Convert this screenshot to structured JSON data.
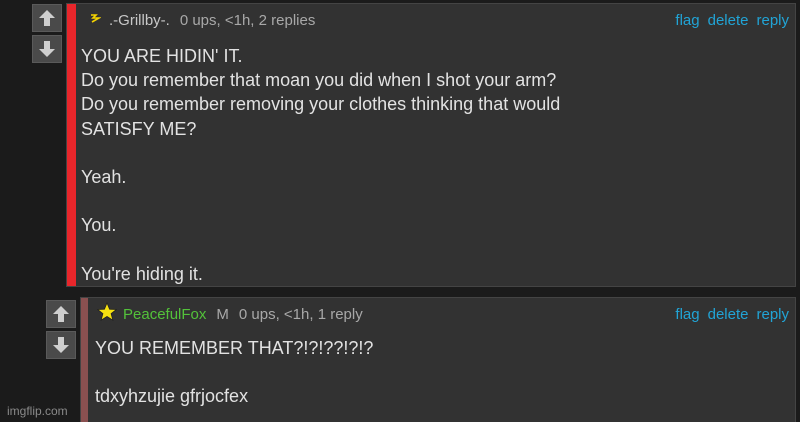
{
  "comments": [
    {
      "username": ".-Grillby-.",
      "username_color": "#c8c8c8",
      "user_icon": "lightning-icon",
      "meta": "0 ups, <1h, 2 replies",
      "flag_label": "flag",
      "delete_label": "delete",
      "reply_label": "reply",
      "bar_color": "#e8262b",
      "body": "YOU ARE HIDIN' IT.\nDo you remember that moan you did when I shot your arm?\nDo you remember removing your clothes thinking that would\nSATISFY ME?\n\nYeah.\n\nYou.\n\nYou're hiding it."
    },
    {
      "username": "PeacefulFox",
      "username_color": "#53c23a",
      "user_icon": "star-icon",
      "mod_badge": "M",
      "meta": "0 ups, <1h, 1 reply",
      "flag_label": "flag",
      "delete_label": "delete",
      "reply_label": "reply",
      "bar_color": "#8a5050",
      "body": "YOU REMEMBER THAT?!?!??!?!?\n\ntdxyhzujie gfrjocfex"
    }
  ],
  "watermark": "imgflip.com"
}
